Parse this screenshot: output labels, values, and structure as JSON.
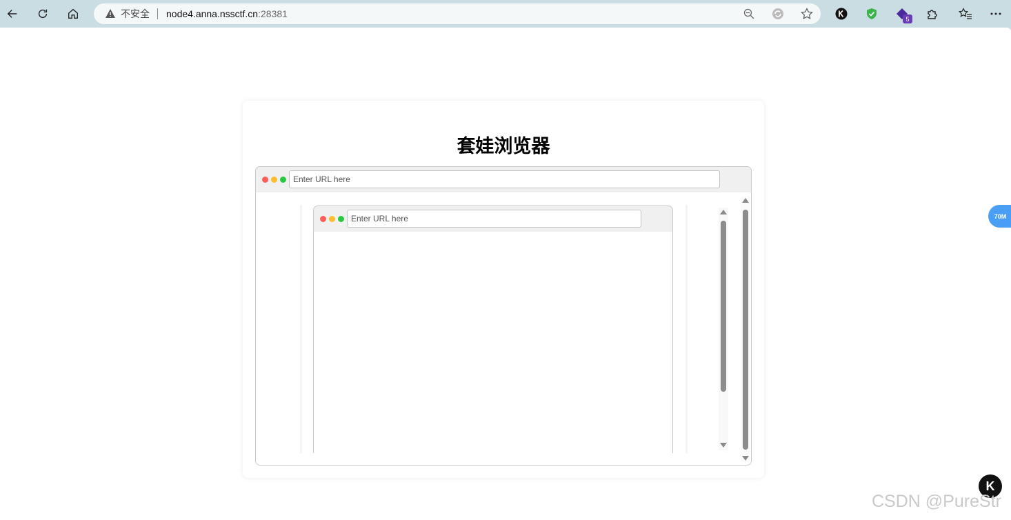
{
  "browser": {
    "security_label": "不安全",
    "url_host": "node4.anna.nssctf.cn",
    "url_port": ":28381",
    "extension_badge": "5"
  },
  "page": {
    "title": "套娃浏览器",
    "outer_browser": {
      "url_placeholder": "Enter URL here",
      "url_value": ""
    },
    "inner_browser": {
      "url_placeholder": "Enter URL here",
      "url_value": ""
    }
  },
  "overlays": {
    "side_widget_label": "70M",
    "corner_widget_label": "K",
    "watermark": "CSDN @PureStr"
  },
  "colors": {
    "chrome_bg": "#c9dde3",
    "dot_red": "#ff5f57",
    "dot_yellow": "#febc2e",
    "dot_green": "#28c840",
    "side_widget": "#4a9ef5"
  }
}
